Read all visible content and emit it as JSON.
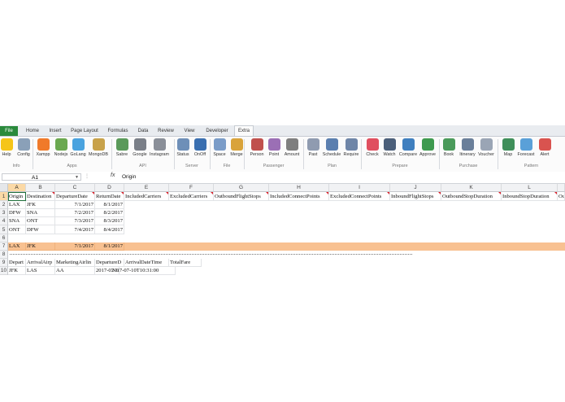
{
  "ribbon": {
    "tabs": [
      "File",
      "Home",
      "Insert",
      "Page Layout",
      "Formulas",
      "Data",
      "Review",
      "View",
      "Developer",
      "Extra"
    ],
    "active_tab": "Extra",
    "buttons": [
      {
        "label": "Help",
        "color": "#f5c518"
      },
      {
        "label": "Config",
        "color": "#8aa0b8"
      },
      {
        "label": "Xampp",
        "color": "#f07a2a"
      },
      {
        "label": "Nodejs",
        "color": "#6aa84f"
      },
      {
        "label": "GoLang",
        "color": "#4aa3df"
      },
      {
        "label": "MongoDB",
        "color": "#c8a24a"
      },
      {
        "label": "Sabre",
        "color": "#5a9a5a"
      },
      {
        "label": "Google",
        "color": "#7a7f88"
      },
      {
        "label": "Instagram",
        "color": "#8a8f98"
      },
      {
        "label": "Status",
        "color": "#6e8fb8"
      },
      {
        "label": "OnOff",
        "color": "#3a6fb0"
      },
      {
        "label": "Space",
        "color": "#7a9cc8"
      },
      {
        "label": "Merge",
        "color": "#d9a33a"
      },
      {
        "label": "Person",
        "color": "#c0504d"
      },
      {
        "label": "Point",
        "color": "#9b6fb5"
      },
      {
        "label": "Amount",
        "color": "#7f7f7f"
      },
      {
        "label": "Past",
        "color": "#8f9bb0"
      },
      {
        "label": "Schedule",
        "color": "#5b7faf"
      },
      {
        "label": "Require",
        "color": "#6f86a8"
      },
      {
        "label": "Check",
        "color": "#e04f5f"
      },
      {
        "label": "Watch",
        "color": "#4b5f7a"
      },
      {
        "label": "Compare",
        "color": "#3f7fbf"
      },
      {
        "label": "Approve",
        "color": "#3e9a4f"
      },
      {
        "label": "Book",
        "color": "#4a9a5a"
      },
      {
        "label": "Itinerary",
        "color": "#6a7f9a"
      },
      {
        "label": "Voucher",
        "color": "#9aa5b5"
      },
      {
        "label": "Map",
        "color": "#3f8f5a"
      },
      {
        "label": "Forecast",
        "color": "#5aa0d8"
      },
      {
        "label": "Alert",
        "color": "#d9534f"
      }
    ],
    "groups": [
      "Info",
      "Apps",
      "API",
      "Server",
      "File",
      "Passenger",
      "Plan",
      "Prepare",
      "Purchase",
      "Pattern"
    ]
  },
  "formula_bar": {
    "name_box": "A1",
    "fx": "fx",
    "value": "Origin"
  },
  "grid": {
    "columns": [
      "A",
      "B",
      "C",
      "D",
      "E",
      "F",
      "G",
      "H",
      "I",
      "J",
      "K",
      "L"
    ],
    "rows": [
      "1",
      "2",
      "3",
      "4",
      "5",
      "6",
      "7",
      "8",
      "9",
      "10"
    ],
    "row1": [
      "Origin",
      "Destination",
      "DepartureDate",
      "ReturnDate",
      "IncludedCarriers",
      "ExcludedCarriers",
      "OutboundFlightStops",
      "IncludedConnectPoints",
      "ExcludedConnectPoints",
      "InboundFlightStops",
      "OutboundStopDuration",
      "InboundStopDuration",
      "Ou"
    ],
    "data_rows": [
      [
        "LAX",
        "JFK",
        "7/1/2017",
        "8/1/2017"
      ],
      [
        "DFW",
        "SNA",
        "7/2/2017",
        "8/2/2017"
      ],
      [
        "SNA",
        "ONT",
        "7/3/2017",
        "8/3/2017"
      ],
      [
        "ONT",
        "DFW",
        "7/4/2017",
        "8/4/2017"
      ]
    ],
    "row7": [
      "LAX",
      "JFK",
      "7/1/2017",
      "8/1/2017"
    ],
    "row9": [
      "Depart",
      "ArrivalAirp",
      "MarketingAirlin",
      "DepartureD",
      "ArrivalDateTime",
      "TotalFare"
    ],
    "row10": [
      "JFK",
      "LAS",
      "AA",
      "2017-07-1(",
      "2017-07-10T10:31:00"
    ]
  }
}
